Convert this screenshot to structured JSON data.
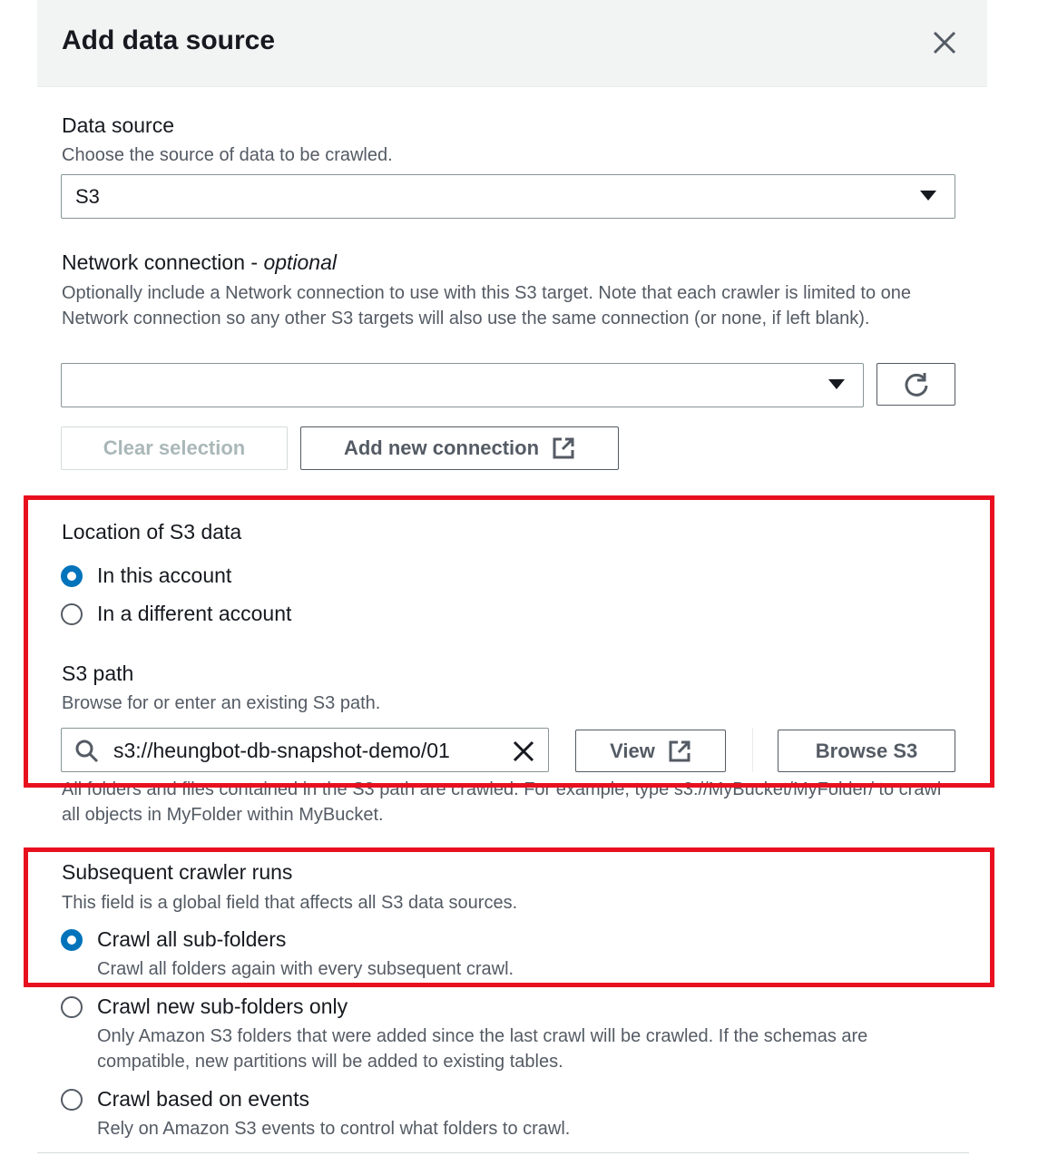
{
  "modal": {
    "title": "Add data source"
  },
  "data_source": {
    "label": "Data source",
    "description": "Choose the source of data to be crawled.",
    "value": "S3"
  },
  "network": {
    "label": "Network connection - ",
    "label_optional": "optional",
    "description": "Optionally include a Network connection to use with this S3 target. Note that each crawler is limited to one Network connection so any other S3 targets will also use the same connection (or none, if left blank).",
    "value": "",
    "clear_label": "Clear selection",
    "add_label": "Add new connection"
  },
  "location": {
    "label": "Location of S3 data",
    "options": [
      {
        "label": "In this account",
        "checked": true
      },
      {
        "label": "In a different account",
        "checked": false
      }
    ]
  },
  "s3_path": {
    "label": "S3 path",
    "description": "Browse for or enter an existing S3 path.",
    "value": "s3://heungbot-db-snapshot-demo/01",
    "view_label": "View",
    "browse_label": "Browse S3",
    "hint": "All folders and files contained in the S3 path are crawled. For example, type s3://MyBucket/MyFolder/ to crawl all objects in MyFolder within MyBucket."
  },
  "subsequent": {
    "label": "Subsequent crawler runs",
    "description": "This field is a global field that affects all S3 data sources.",
    "options": [
      {
        "label": "Crawl all sub-folders",
        "desc": "Crawl all folders again with every subsequent crawl.",
        "checked": true
      },
      {
        "label": "Crawl new sub-folders only",
        "desc": "Only Amazon S3 folders that were added since the last crawl will be crawled. If the schemas are compatible, new partitions will be added to existing tables.",
        "checked": false
      },
      {
        "label": "Crawl based on events",
        "desc": "Rely on Amazon S3 events to control what folders to crawl.",
        "checked": false
      }
    ]
  },
  "colors": {
    "accent": "#0073bb",
    "highlight": "#e8101f",
    "text": "#16191f",
    "muted": "#545b64"
  }
}
